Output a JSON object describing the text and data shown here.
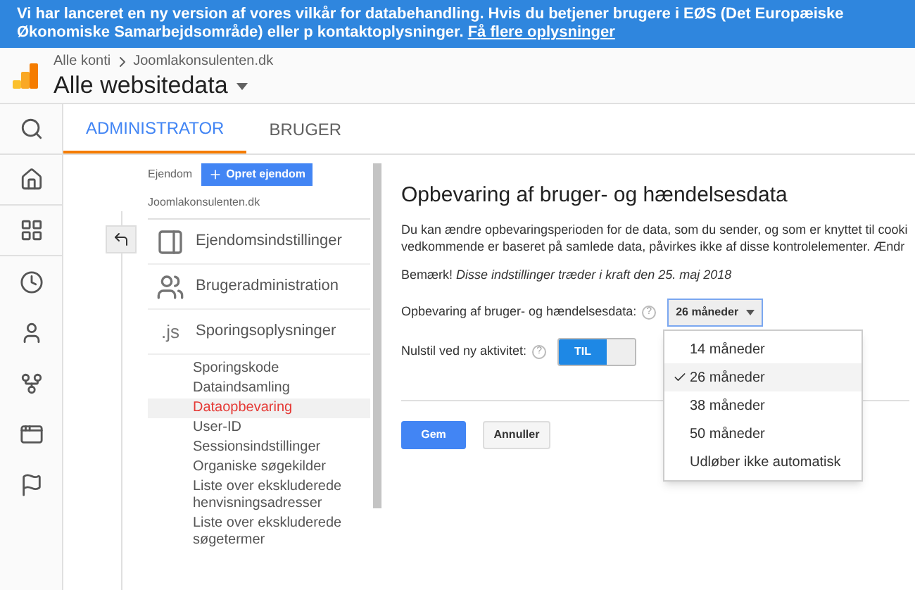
{
  "banner": {
    "text": "Vi har lanceret en ny version af vores vilkår for databehandling. Hvis du betjener brugere i EØS (Det Europæiske Økonomiske Samarbejdsområde) eller p kontaktoplysninger.",
    "link": "Få flere oplysninger"
  },
  "header": {
    "breadcrumb": [
      "Alle konti",
      "Joomlakonsulenten.dk"
    ],
    "view": "Alle websitedata"
  },
  "tabs": [
    {
      "label": "ADMINISTRATOR",
      "selected": true
    },
    {
      "label": "BRUGER",
      "selected": false
    }
  ],
  "property": {
    "label": "Ejendom",
    "create_button": "Opret ejendom",
    "name": "Joomlakonsulenten.dk"
  },
  "nav": [
    {
      "kind": "panel",
      "label": "Ejendomsindstillinger"
    },
    {
      "kind": "users",
      "label": "Brugeradministration"
    },
    {
      "kind": "text",
      "icon_text": ".js",
      "label": "Sporingsoplysninger"
    }
  ],
  "sub_items": [
    {
      "label": "Sporingskode",
      "selected": false
    },
    {
      "label": "Dataindsamling",
      "selected": false
    },
    {
      "label": "Dataopbevaring",
      "selected": true
    },
    {
      "label": "User-ID",
      "selected": false
    },
    {
      "label": "Sessionsindstillinger",
      "selected": false
    },
    {
      "label": "Organiske søgekilder",
      "selected": false
    },
    {
      "label": "Liste over ekskluderede henvisningsadresser",
      "selected": false
    },
    {
      "label": "Liste over ekskluderede søgetermer",
      "selected": false
    }
  ],
  "panel": {
    "title": "Opbevaring af bruger- og hændelsesdata",
    "description": "Du kan ændre opbevaringsperioden for de data, som du sender, og som er knyttet til cooki vedkommende er baseret på samlede data, påvirkes ikke af disse kontrolelementer. Ændr",
    "note_label": "Bemærk!",
    "note": "Disse indstillinger træder i kraft den 25. maj 2018",
    "retention": {
      "label": "Opbevaring af bruger- og hændelsesdata:",
      "help": "?",
      "value": "26 måneder",
      "expanded": true,
      "options": [
        {
          "label": "14 måneder",
          "selected": false
        },
        {
          "label": "26 måneder",
          "selected": true
        },
        {
          "label": "38 måneder",
          "selected": false
        },
        {
          "label": "50 måneder",
          "selected": false
        },
        {
          "label": "Udløber ikke automatisk",
          "selected": false
        }
      ]
    },
    "reset": {
      "label": "Nulstil ved ny aktivitet:",
      "help": "?",
      "toggle_label": "TIL",
      "on": true
    },
    "save": "Gem",
    "cancel": "Annuller"
  }
}
